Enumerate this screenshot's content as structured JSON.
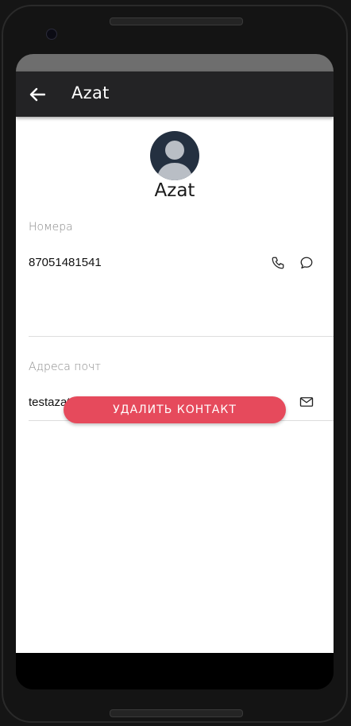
{
  "app_bar": {
    "back_icon": "arrow-left-icon",
    "title": "Azat"
  },
  "contact": {
    "avatar_icon": "person-avatar-icon",
    "name": "Azat"
  },
  "phones": {
    "label": "Номера",
    "number": "87051481541",
    "call_icon": "phone-icon",
    "message_icon": "chat-bubble-icon"
  },
  "emails": {
    "label": "Адреса почт",
    "address": "testazat@gmail.com",
    "mail_icon": "envelope-icon"
  },
  "actions": {
    "delete_label": "УДАЛИТЬ КОНТАКТ"
  },
  "colors": {
    "app_bar": "#232325",
    "delete_button": "#e64a5c",
    "avatar_bg": "#243040"
  }
}
